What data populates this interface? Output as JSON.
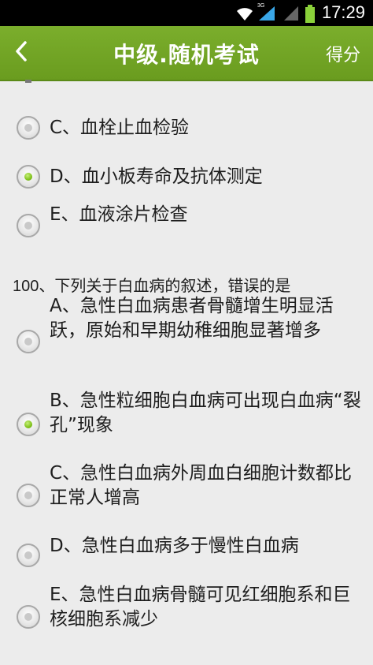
{
  "status_bar": {
    "time": "17:29",
    "network": "3G"
  },
  "header": {
    "title": "中级.随机考试",
    "score_label": "得分"
  },
  "prev_question_options": [
    {
      "label": "C、血栓止血检验",
      "checked": false
    },
    {
      "label": "D、血小板寿命及抗体测定",
      "checked": true
    },
    {
      "label": "E、血液涂片检查",
      "checked": false
    }
  ],
  "question": {
    "number": "100、",
    "text": "下列关于白血病的叙述，错误的是",
    "options": [
      {
        "label": "A、急性白血病患者骨髓增生明显活跃，原始和早期幼稚细胞显著增多",
        "checked": false
      },
      {
        "label": "B、急性粒细胞白血病可出现白血病“裂 孔”现象",
        "checked": true
      },
      {
        "label": "C、急性白血病外周血白细胞计数都比正常人增高",
        "checked": false
      },
      {
        "label": "D、急性白血病多于慢性白血病",
        "checked": false
      },
      {
        "label": "E、急性白血病骨髓可见红细胞系和巨核细胞系减少",
        "checked": false
      }
    ]
  },
  "colors": {
    "header_green": "#6fa124",
    "radio_selected": "#7fc11a"
  }
}
